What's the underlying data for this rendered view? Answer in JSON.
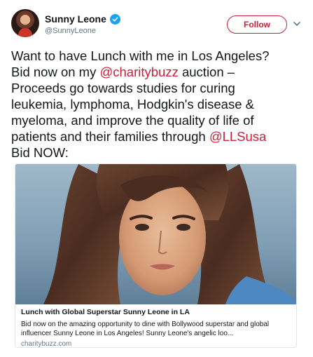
{
  "user": {
    "display_name": "Sunny Leone",
    "handle": "@SunnyLeone",
    "verified": true
  },
  "actions": {
    "follow_label": "Follow",
    "more_icon": "chevron-down-icon"
  },
  "tweet": {
    "segments": [
      {
        "text": "Want to have Lunch with me in Los Angeles?"
      },
      {
        "text": "Bid now on my "
      },
      {
        "text": "@charitybuzz"
      },
      {
        "text": " auction –"
      },
      {
        "text": "Proceeds go towards studies for curing"
      },
      {
        "text": "leukemia, lymphoma, Hodgkin's disease &"
      },
      {
        "text": "myeloma, and improve the quality of life of"
      },
      {
        "text": "patients and their families through "
      },
      {
        "text": "@LLSusa"
      },
      {
        "text": "Bid NOW:"
      }
    ]
  },
  "card": {
    "title": "Lunch with Global Superstar Sunny Leone in LA",
    "description_line1": "Bid now on the amazing opportunity to dine with Bollywood superstar and global",
    "description_line2": "influencer Sunny Leone in Los Angeles! Sunny Leone's angelic loo...",
    "domain": "charitybuzz.com"
  },
  "colors": {
    "accent": "#c9213a",
    "verified": "#1da1f2",
    "secondary_text": "#657786",
    "border": "#e1e8ed"
  }
}
